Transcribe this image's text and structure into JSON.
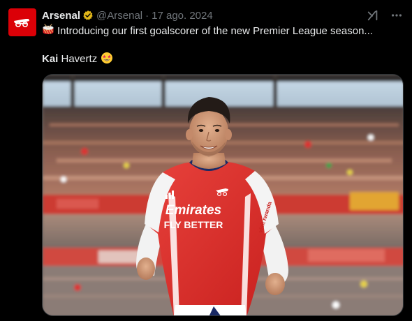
{
  "account": {
    "name": "Arsenal",
    "handle": "@Arsenal",
    "separator": "·",
    "date": "17 ago. 2024"
  },
  "tweet": {
    "line1_text": "Introducing our first goalscorer of the new Premier League season...",
    "line1_emoji": "drum-emoji",
    "line2_bold": "Kai",
    "line2_text": " Havertz",
    "line2_emoji": "star-struck-emoji"
  },
  "media": {
    "description_icon": "photo",
    "shirt_sponsor": "Emirates",
    "shirt_slogan": "FLY BETTER",
    "sleeve_text": "visit rwanda"
  },
  "icons": {
    "verified": "verified-badge-icon",
    "grok": "grok-icon",
    "more": "more-icon"
  },
  "colors": {
    "background": "#000000",
    "text_primary": "#e7e9ea",
    "text_secondary": "#71767b",
    "verified_gold": "#e2b719",
    "arsenal_red": "#db0007"
  }
}
